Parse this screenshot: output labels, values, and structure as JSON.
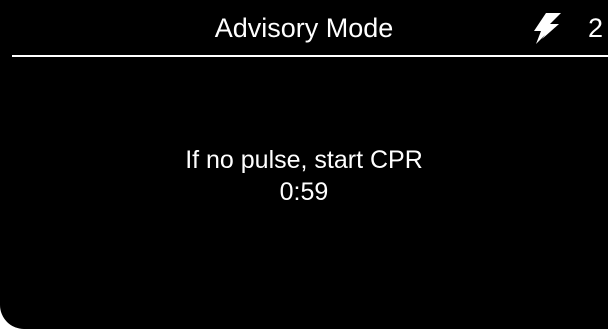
{
  "header": {
    "title": "Advisory Mode",
    "shock_icon": "lightning-bolt-icon",
    "shock_count": "2"
  },
  "main": {
    "message": "If no pulse, start CPR",
    "timer": "0:59"
  },
  "colors": {
    "background": "#000000",
    "foreground": "#ffffff"
  }
}
